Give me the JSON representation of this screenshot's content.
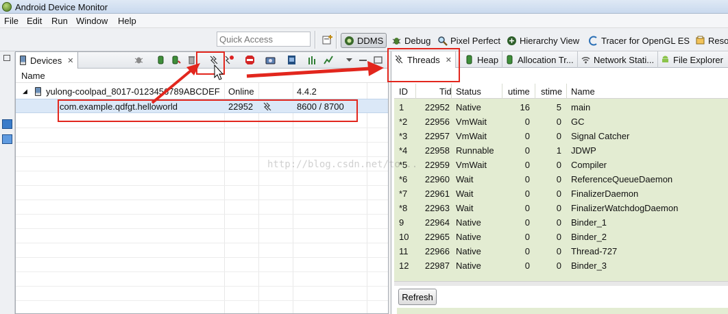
{
  "window": {
    "title": "Android Device Monitor"
  },
  "menu": [
    "File",
    "Edit",
    "Run",
    "Window",
    "Help"
  ],
  "toolbar": {
    "quick_access_placeholder": "Quick Access",
    "perspectives": [
      "DDMS",
      "Debug",
      "Pixel Perfect",
      "Hierarchy View",
      "Tracer for OpenGL ES",
      "Reso"
    ],
    "active_perspective": "DDMS"
  },
  "devices_view": {
    "tab_label": "Devices",
    "column_header": "Name",
    "device": {
      "name": "yulong-coolpad_8017-0123456789ABCDEF",
      "status": "Online",
      "version": "4.4.2"
    },
    "process": {
      "name": "com.example.qdfgt.helloworld",
      "pid": "22952",
      "ports": "8600 / 8700"
    }
  },
  "threads_view": {
    "tabs": [
      "Threads",
      "Heap",
      "Allocation Tr...",
      "Network Stati...",
      "File Explorer"
    ],
    "active_tab": "Threads",
    "columns": [
      "ID",
      "Tid",
      "Status",
      "utime",
      "stime",
      "Name"
    ],
    "rows": [
      {
        "id": "1",
        "tid": "22952",
        "status": "Native",
        "utime": "16",
        "stime": "5",
        "name": "main"
      },
      {
        "id": "*2",
        "tid": "22956",
        "status": "VmWait",
        "utime": "0",
        "stime": "0",
        "name": "GC"
      },
      {
        "id": "*3",
        "tid": "22957",
        "status": "VmWait",
        "utime": "0",
        "stime": "0",
        "name": "Signal Catcher"
      },
      {
        "id": "*4",
        "tid": "22958",
        "status": "Runnable",
        "utime": "0",
        "stime": "1",
        "name": "JDWP"
      },
      {
        "id": "*5",
        "tid": "22959",
        "status": "VmWait",
        "utime": "0",
        "stime": "0",
        "name": "Compiler"
      },
      {
        "id": "*6",
        "tid": "22960",
        "status": "Wait",
        "utime": "0",
        "stime": "0",
        "name": "ReferenceQueueDaemon"
      },
      {
        "id": "*7",
        "tid": "22961",
        "status": "Wait",
        "utime": "0",
        "stime": "0",
        "name": "FinalizerDaemon"
      },
      {
        "id": "*8",
        "tid": "22963",
        "status": "Wait",
        "utime": "0",
        "stime": "0",
        "name": "FinalizerWatchdogDaemon"
      },
      {
        "id": "9",
        "tid": "22964",
        "status": "Native",
        "utime": "0",
        "stime": "0",
        "name": "Binder_1"
      },
      {
        "id": "10",
        "tid": "22965",
        "status": "Native",
        "utime": "0",
        "stime": "0",
        "name": "Binder_2"
      },
      {
        "id": "11",
        "tid": "22966",
        "status": "Native",
        "utime": "0",
        "stime": "0",
        "name": "Thread-727"
      },
      {
        "id": "12",
        "tid": "22987",
        "status": "Native",
        "utime": "0",
        "stime": "0",
        "name": "Binder_3"
      }
    ],
    "refresh_label": "Refresh"
  },
  "watermark": "http://blog.csdn.net/to...",
  "colors": {
    "annotation": "#e2261d",
    "table_bg": "#e3ecd2",
    "selection": "#dbe8f7"
  }
}
